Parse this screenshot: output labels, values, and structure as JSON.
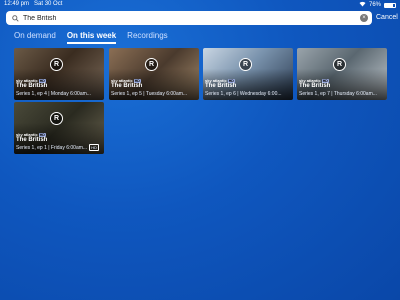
{
  "status": {
    "time": "12:49 pm",
    "date": "Sat 30 Oct",
    "battery": "76%",
    "battery_fill": 0.76
  },
  "search": {
    "value": "The British",
    "placeholder": "",
    "cancel_label": "Cancel"
  },
  "tabs": [
    {
      "label": "On demand"
    },
    {
      "label": "On this week"
    },
    {
      "label": "Recordings"
    }
  ],
  "active_tab": "On this week",
  "results": [
    {
      "badge": "R",
      "channel_logo": "sky",
      "channel_name": "atlantic",
      "channel_tag": "HD",
      "title": "The British",
      "meta": "Series 1, ep 4 | Monday 6:00am..."
    },
    {
      "badge": "R",
      "channel_logo": "sky",
      "channel_name": "atlantic",
      "channel_tag": "HD",
      "title": "The British",
      "meta": "Series 1, ep 5 | Tuesday 6:00am..."
    },
    {
      "badge": "R",
      "channel_logo": "sky",
      "channel_name": "atlantic",
      "channel_tag": "HD",
      "title": "The British",
      "meta": "Series 1, ep 6 | Wednesday 6:00..."
    },
    {
      "badge": "R",
      "channel_logo": "sky",
      "channel_name": "atlantic",
      "channel_tag": "HD",
      "title": "The British",
      "meta": "Series 1, ep 7 | Thursday 6:00am..."
    },
    {
      "badge": "R",
      "channel_logo": "sky",
      "channel_name": "atlantic",
      "channel_tag": "HD",
      "title": "The British",
      "meta": "Series 1, ep 1 | Friday 6:00am...",
      "meta_tag": "HD"
    }
  ],
  "colors": {
    "background": "#0f57bf",
    "active_tab": "#ffffff",
    "search_bg": "#ffffff"
  },
  "icons": {
    "search": "search-icon",
    "clear": "clear-icon",
    "wifi": "wifi-icon",
    "battery": "battery-icon",
    "record": "record-badge-icon"
  }
}
